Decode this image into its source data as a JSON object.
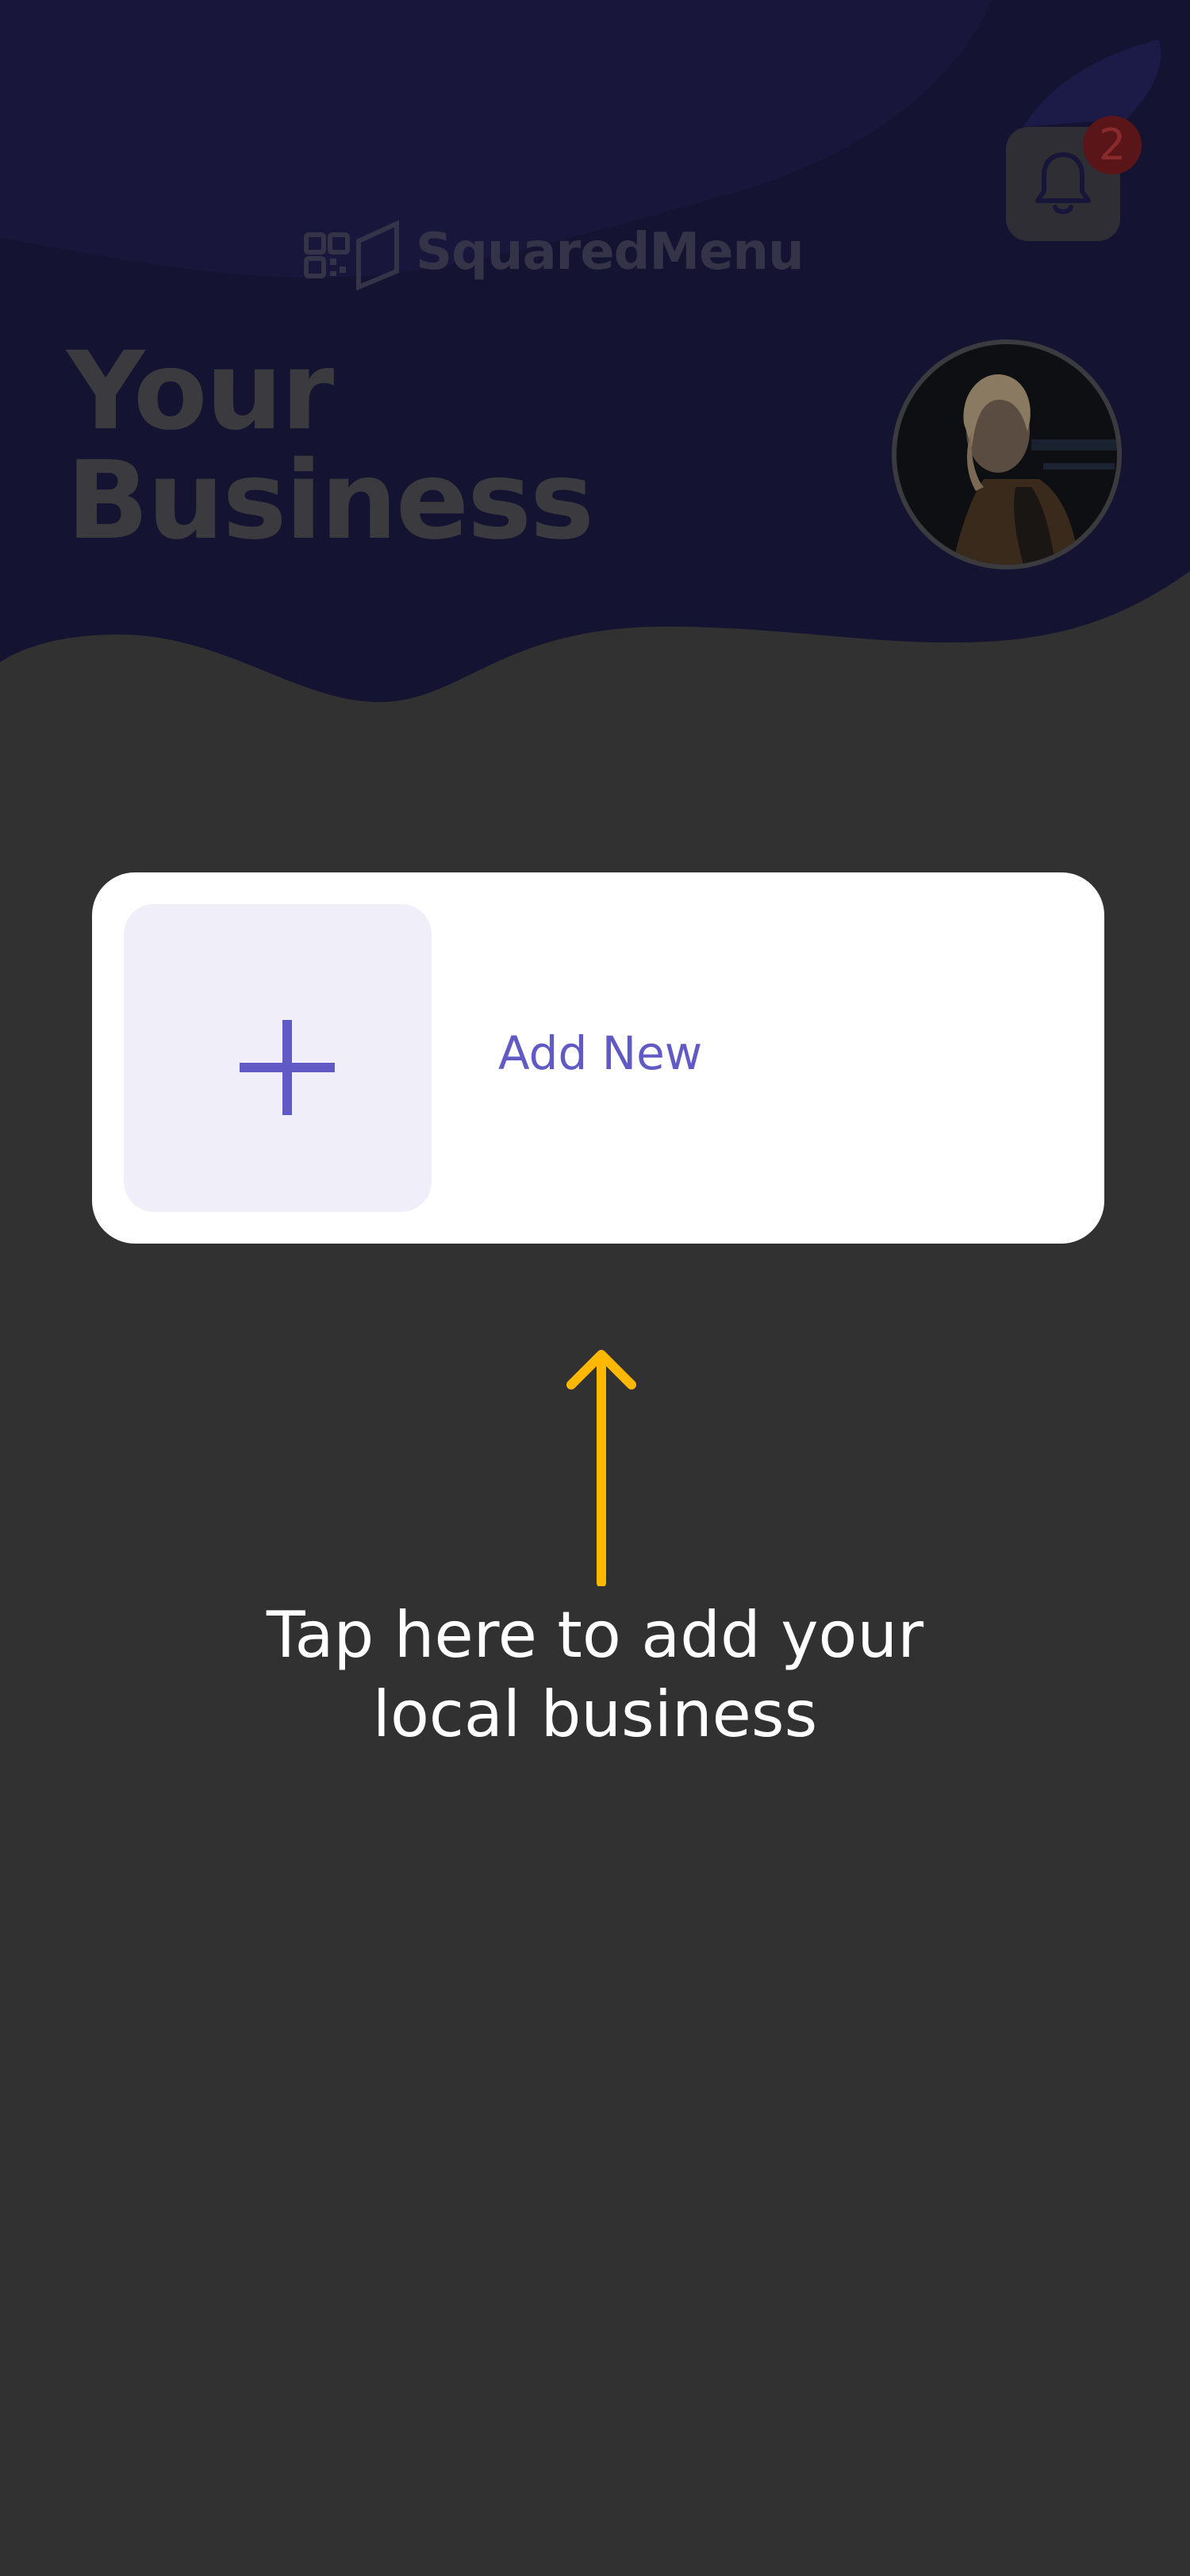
{
  "app": {
    "logo_text": "SquaredMenu"
  },
  "header": {
    "title_line_1": "Your",
    "title_line_2": "Business",
    "notifications": {
      "icon": "bell-icon",
      "count": "2"
    },
    "avatar": {
      "icon": "user-avatar"
    }
  },
  "add_card": {
    "icon": "plus-icon",
    "label": "Add New"
  },
  "onboarding": {
    "arrow_icon": "arrow-up-icon",
    "hint_line_1": "Tap here to add your",
    "hint_line_2": "local business"
  },
  "colors": {
    "background_overlay": "#313131",
    "header_background": "#141332",
    "accent": "#6159C4",
    "tile_background": "#EFEEF9",
    "arrow": "#FFB800",
    "badge": "#5A1518"
  }
}
